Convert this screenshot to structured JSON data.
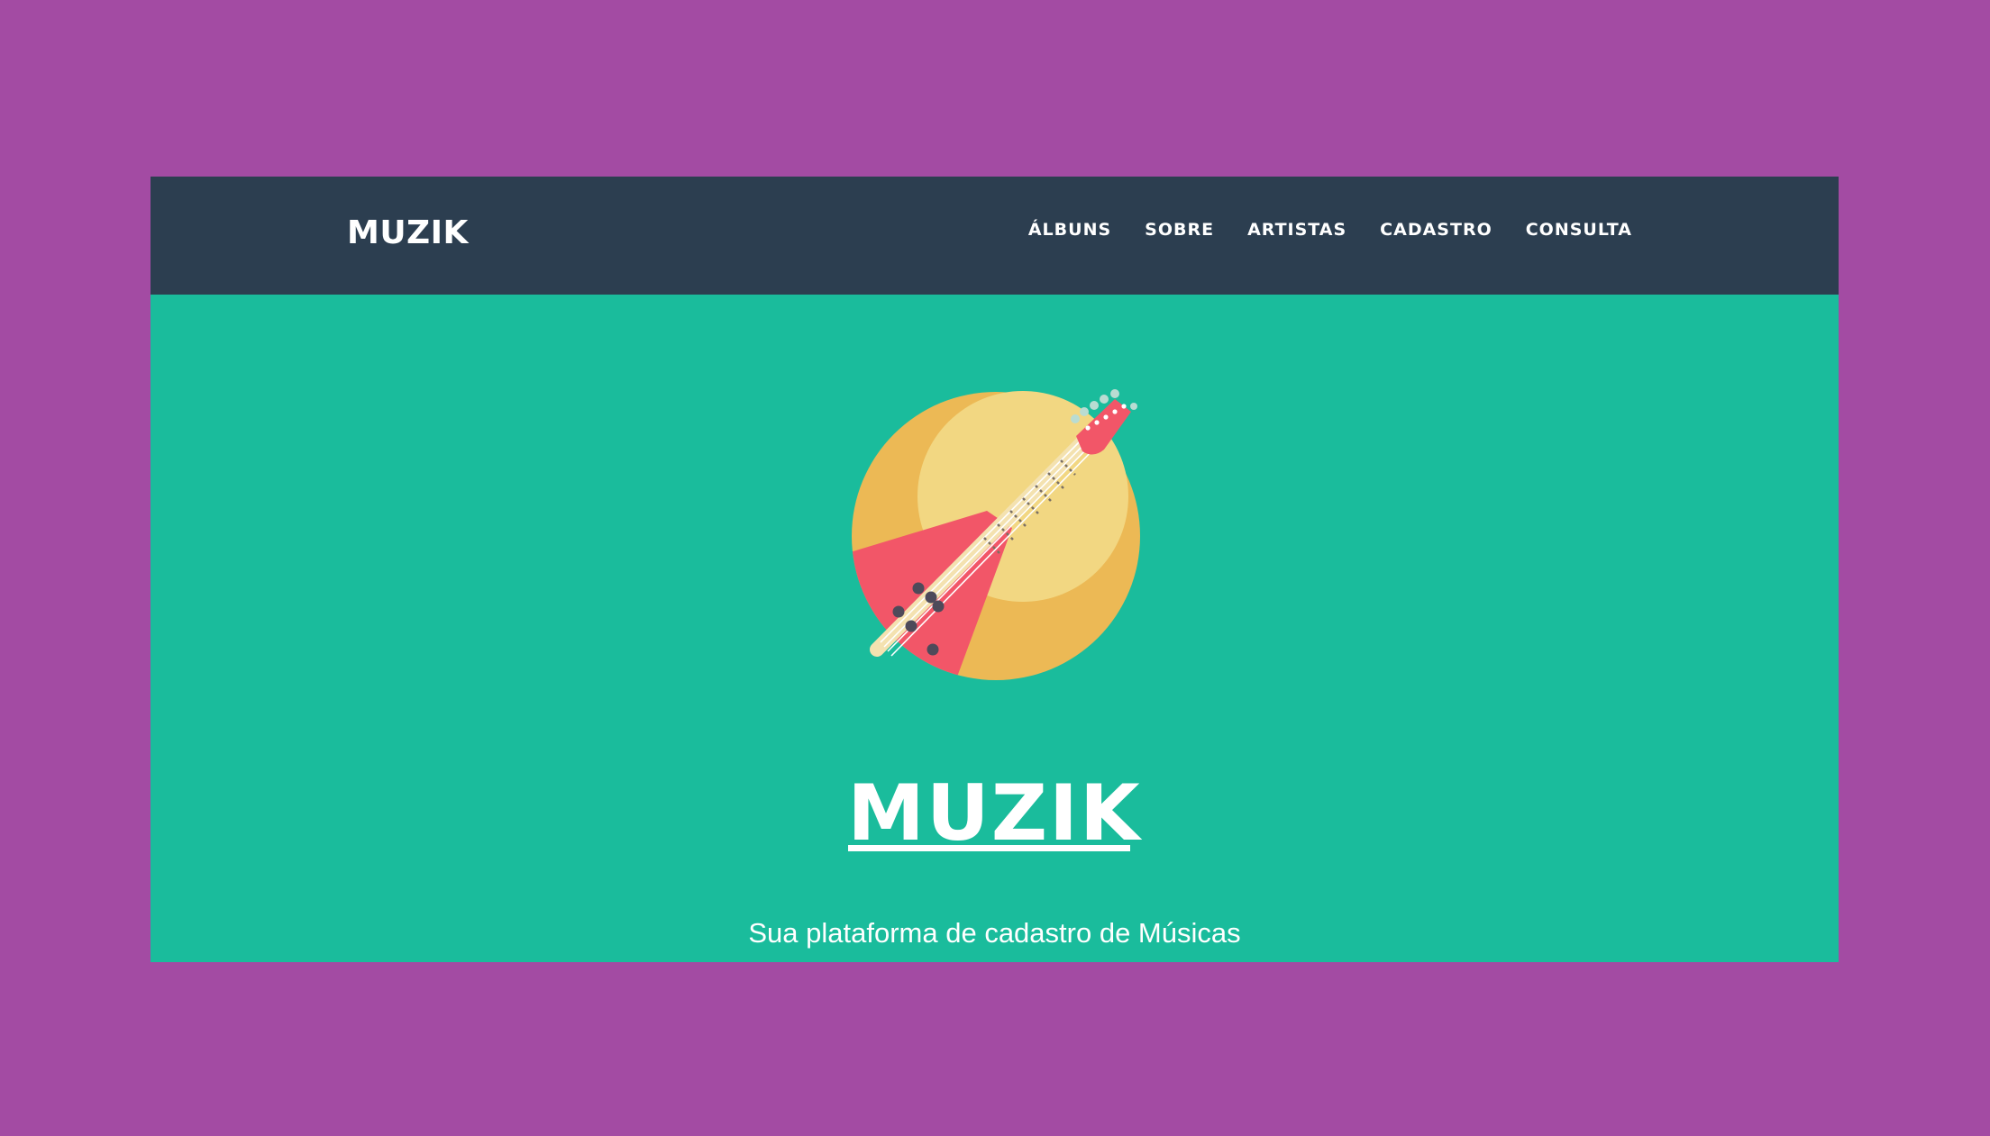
{
  "navbar": {
    "brand": "MUZIK",
    "links": [
      {
        "label": "ÁLBUNS"
      },
      {
        "label": "SOBRE"
      },
      {
        "label": "ARTISTAS"
      },
      {
        "label": "CADASTRO"
      },
      {
        "label": "CONSULTA"
      }
    ]
  },
  "hero": {
    "logo_icon": "guitar-icon",
    "title": "MUZIK",
    "subtitle": "Sua plataforma de cadastro de Músicas"
  },
  "colors": {
    "page_background": "#a34ba3",
    "navbar_background": "#2c3e50",
    "hero_background": "#1abc9c",
    "text": "#ffffff",
    "logo_outer_circle": "#ecb955",
    "logo_inner_circle": "#f2d782",
    "guitar_body": "#f25668",
    "guitar_pins": "#4e4a5a"
  }
}
